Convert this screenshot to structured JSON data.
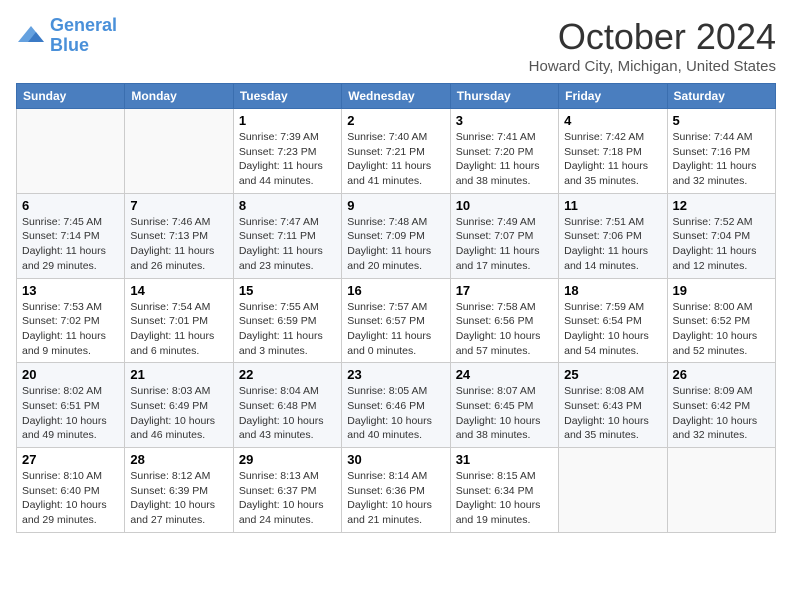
{
  "header": {
    "logo": {
      "line1": "General",
      "line2": "Blue"
    },
    "title": "October 2024",
    "location": "Howard City, Michigan, United States"
  },
  "days_of_week": [
    "Sunday",
    "Monday",
    "Tuesday",
    "Wednesday",
    "Thursday",
    "Friday",
    "Saturday"
  ],
  "weeks": [
    [
      {
        "day": "",
        "info": ""
      },
      {
        "day": "",
        "info": ""
      },
      {
        "day": "1",
        "info": "Sunrise: 7:39 AM\nSunset: 7:23 PM\nDaylight: 11 hours and 44 minutes."
      },
      {
        "day": "2",
        "info": "Sunrise: 7:40 AM\nSunset: 7:21 PM\nDaylight: 11 hours and 41 minutes."
      },
      {
        "day": "3",
        "info": "Sunrise: 7:41 AM\nSunset: 7:20 PM\nDaylight: 11 hours and 38 minutes."
      },
      {
        "day": "4",
        "info": "Sunrise: 7:42 AM\nSunset: 7:18 PM\nDaylight: 11 hours and 35 minutes."
      },
      {
        "day": "5",
        "info": "Sunrise: 7:44 AM\nSunset: 7:16 PM\nDaylight: 11 hours and 32 minutes."
      }
    ],
    [
      {
        "day": "6",
        "info": "Sunrise: 7:45 AM\nSunset: 7:14 PM\nDaylight: 11 hours and 29 minutes."
      },
      {
        "day": "7",
        "info": "Sunrise: 7:46 AM\nSunset: 7:13 PM\nDaylight: 11 hours and 26 minutes."
      },
      {
        "day": "8",
        "info": "Sunrise: 7:47 AM\nSunset: 7:11 PM\nDaylight: 11 hours and 23 minutes."
      },
      {
        "day": "9",
        "info": "Sunrise: 7:48 AM\nSunset: 7:09 PM\nDaylight: 11 hours and 20 minutes."
      },
      {
        "day": "10",
        "info": "Sunrise: 7:49 AM\nSunset: 7:07 PM\nDaylight: 11 hours and 17 minutes."
      },
      {
        "day": "11",
        "info": "Sunrise: 7:51 AM\nSunset: 7:06 PM\nDaylight: 11 hours and 14 minutes."
      },
      {
        "day": "12",
        "info": "Sunrise: 7:52 AM\nSunset: 7:04 PM\nDaylight: 11 hours and 12 minutes."
      }
    ],
    [
      {
        "day": "13",
        "info": "Sunrise: 7:53 AM\nSunset: 7:02 PM\nDaylight: 11 hours and 9 minutes."
      },
      {
        "day": "14",
        "info": "Sunrise: 7:54 AM\nSunset: 7:01 PM\nDaylight: 11 hours and 6 minutes."
      },
      {
        "day": "15",
        "info": "Sunrise: 7:55 AM\nSunset: 6:59 PM\nDaylight: 11 hours and 3 minutes."
      },
      {
        "day": "16",
        "info": "Sunrise: 7:57 AM\nSunset: 6:57 PM\nDaylight: 11 hours and 0 minutes."
      },
      {
        "day": "17",
        "info": "Sunrise: 7:58 AM\nSunset: 6:56 PM\nDaylight: 10 hours and 57 minutes."
      },
      {
        "day": "18",
        "info": "Sunrise: 7:59 AM\nSunset: 6:54 PM\nDaylight: 10 hours and 54 minutes."
      },
      {
        "day": "19",
        "info": "Sunrise: 8:00 AM\nSunset: 6:52 PM\nDaylight: 10 hours and 52 minutes."
      }
    ],
    [
      {
        "day": "20",
        "info": "Sunrise: 8:02 AM\nSunset: 6:51 PM\nDaylight: 10 hours and 49 minutes."
      },
      {
        "day": "21",
        "info": "Sunrise: 8:03 AM\nSunset: 6:49 PM\nDaylight: 10 hours and 46 minutes."
      },
      {
        "day": "22",
        "info": "Sunrise: 8:04 AM\nSunset: 6:48 PM\nDaylight: 10 hours and 43 minutes."
      },
      {
        "day": "23",
        "info": "Sunrise: 8:05 AM\nSunset: 6:46 PM\nDaylight: 10 hours and 40 minutes."
      },
      {
        "day": "24",
        "info": "Sunrise: 8:07 AM\nSunset: 6:45 PM\nDaylight: 10 hours and 38 minutes."
      },
      {
        "day": "25",
        "info": "Sunrise: 8:08 AM\nSunset: 6:43 PM\nDaylight: 10 hours and 35 minutes."
      },
      {
        "day": "26",
        "info": "Sunrise: 8:09 AM\nSunset: 6:42 PM\nDaylight: 10 hours and 32 minutes."
      }
    ],
    [
      {
        "day": "27",
        "info": "Sunrise: 8:10 AM\nSunset: 6:40 PM\nDaylight: 10 hours and 29 minutes."
      },
      {
        "day": "28",
        "info": "Sunrise: 8:12 AM\nSunset: 6:39 PM\nDaylight: 10 hours and 27 minutes."
      },
      {
        "day": "29",
        "info": "Sunrise: 8:13 AM\nSunset: 6:37 PM\nDaylight: 10 hours and 24 minutes."
      },
      {
        "day": "30",
        "info": "Sunrise: 8:14 AM\nSunset: 6:36 PM\nDaylight: 10 hours and 21 minutes."
      },
      {
        "day": "31",
        "info": "Sunrise: 8:15 AM\nSunset: 6:34 PM\nDaylight: 10 hours and 19 minutes."
      },
      {
        "day": "",
        "info": ""
      },
      {
        "day": "",
        "info": ""
      }
    ]
  ]
}
